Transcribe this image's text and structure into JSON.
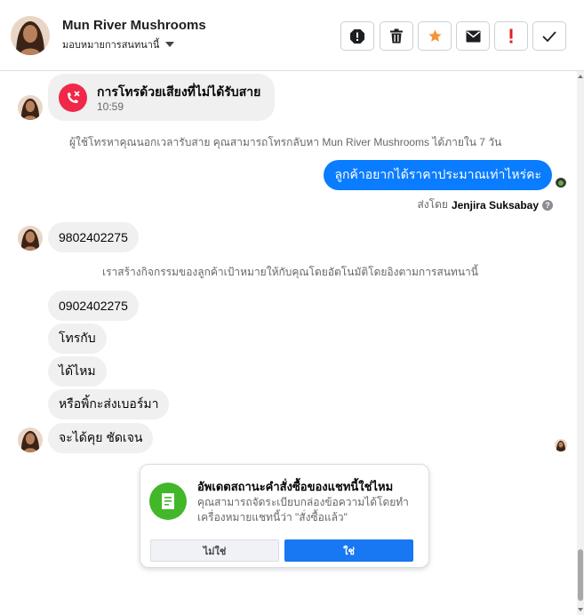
{
  "header": {
    "contact_name": "Mun River Mushrooms",
    "assign_label": "มอบหมายการสนทนานี้",
    "toolbar": [
      {
        "icon": "spam-icon"
      },
      {
        "icon": "trash-icon"
      },
      {
        "icon": "star-icon",
        "color": "#f7923b"
      },
      {
        "icon": "mail-icon"
      },
      {
        "icon": "important-icon",
        "color": "#e02020"
      },
      {
        "icon": "check-icon"
      }
    ]
  },
  "thread": {
    "missed_call": {
      "title": "การโทรด้วยเสียงที่ไม่ได้รับสาย",
      "time": "10:59"
    },
    "missed_call_note": "ผู้ใช้โทรหาคุณนอกเวลารับสาย คุณสามารถโทรกลับหา Mun River Mushrooms ได้ภายใน 7 วัน",
    "outgoing_message": "ลูกค้าอยากได้ราคาประมาณเท่าไหร่คะ",
    "sent_by_prefix": "ส่งโดย",
    "sent_by_name": "Jenjira Suksabay",
    "incoming_first": "9802402275",
    "activity_note": "เราสร้างกิจกรรมของลูกค้าเป้าหมายให้กับคุณโดยอัตโนมัติโดยอิงตามการสนทนานี้",
    "incoming_group": [
      "0902402275",
      "โทรกับ",
      "ได้ไหม",
      "หรือพิ้กะส่งเบอร์มา",
      "จะได้คุย ชัดเจน"
    ]
  },
  "order_card": {
    "title": "อัพเดตสถานะคำสั่งซื้อของแชทนี้ใช่ไหม",
    "description": "คุณสามารถจัดระเบียบกล่องข้อความได้โดยทำเครื่องหมายแชทนี้ว่า \"สั่งซื้อแล้ว\"",
    "no_label": "ไม่ใช่",
    "yes_label": "ใช่"
  },
  "colors": {
    "accent_blue": "#0a7cff",
    "button_blue": "#1877f2",
    "missed_call_red": "#f02849",
    "order_green": "#42b72a"
  }
}
